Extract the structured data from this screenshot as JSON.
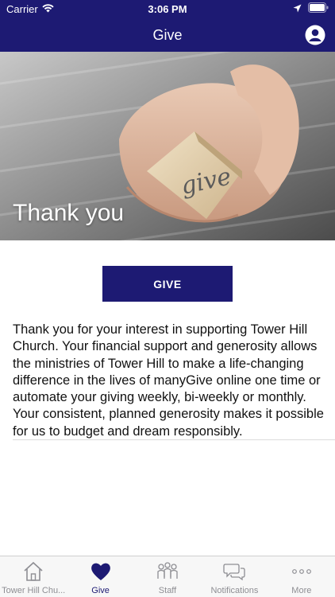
{
  "status_bar": {
    "carrier": "Carrier",
    "time": "3:06 PM"
  },
  "nav": {
    "title": "Give",
    "profile_icon": "profile-icon"
  },
  "hero": {
    "caption": "Thank you",
    "block_word": "give"
  },
  "give_button": {
    "label": "GIVE"
  },
  "body": {
    "text": "Thank you for your interest in supporting Tower Hill Church. Your financial support and generosity allows the ministries of Tower Hill to make a life-changing difference in the lives of manyGive online one time or automate your giving weekly, bi-weekly or monthly. Your consistent, planned generosity makes it possible for us to budget and dream responsibly."
  },
  "tabs": [
    {
      "label": "Tower Hill Chu...",
      "icon": "home-icon",
      "active": false
    },
    {
      "label": "Give",
      "icon": "heart-icon",
      "active": true
    },
    {
      "label": "Staff",
      "icon": "people-icon",
      "active": false
    },
    {
      "label": "Notifications",
      "icon": "chat-icon",
      "active": false
    },
    {
      "label": "More",
      "icon": "more-icon",
      "active": false
    }
  ],
  "colors": {
    "brand": "#1d1a73",
    "tab_inactive": "#8e8e93",
    "background": "#ffffff"
  }
}
